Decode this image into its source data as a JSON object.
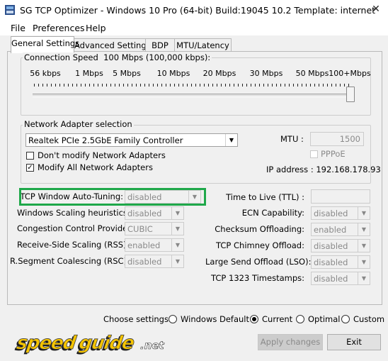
{
  "window": {
    "title": "SG TCP Optimizer - Windows 10 Pro (64-bit) Build:19045 10.2  Template: internet",
    "close_glyph": "✕"
  },
  "menu": [
    "File",
    "Preferences",
    "Help"
  ],
  "tabs": [
    "General Settings",
    "Advanced Settings",
    "BDP",
    "MTU/Latency"
  ],
  "connection_speed": {
    "label": "Connection Speed",
    "value_text": "100 Mbps (100,000 kbps):",
    "ticks": [
      "56 kbps",
      "1 Mbps",
      "5 Mbps",
      "10 Mbps",
      "20 Mbps",
      "30 Mbps",
      "50 Mbps",
      "100+Mbps"
    ],
    "slider_value_index": 7
  },
  "network_adapter": {
    "label": "Network Adapter selection",
    "selected": "Realtek PCIe 2.5GbE Family Controller",
    "dont_modify_label": "Don't modify Network Adapters",
    "dont_modify_checked": false,
    "modify_all_label": "Modify All Network Adapters",
    "modify_all_checked": true,
    "mtu_label": "MTU :",
    "mtu_value": "1500",
    "pppoe_label": "PPPoE",
    "pppoe_checked": false,
    "ip_label": "IP address : 192.168.178.93"
  },
  "left_settings": [
    {
      "label": "TCP Window Auto-Tuning:",
      "value": "disabled"
    },
    {
      "label": "Windows Scaling heuristics:",
      "value": "disabled"
    },
    {
      "label": "Congestion Control Provider:",
      "value": "CUBIC"
    },
    {
      "label": "Receive-Side Scaling (RSS):",
      "value": "enabled"
    },
    {
      "label": "R.Segment Coalescing (RSC):",
      "value": "disabled"
    }
  ],
  "right_settings": [
    {
      "label": "Time to Live (TTL) :",
      "value": ""
    },
    {
      "label": "ECN Capability:",
      "value": "disabled"
    },
    {
      "label": "Checksum Offloading:",
      "value": "enabled"
    },
    {
      "label": "TCP Chimney Offload:",
      "value": "disabled"
    },
    {
      "label": "Large Send Offload (LSO):",
      "value": "disabled"
    },
    {
      "label": "TCP 1323 Timestamps:",
      "value": "disabled"
    }
  ],
  "choose_settings": {
    "label": "Choose settings:",
    "options": [
      "Windows Default",
      "Current",
      "Optimal",
      "Custom"
    ],
    "selected": "Current"
  },
  "footer": {
    "logo_text": "speedguide.net",
    "apply_label": "Apply changes",
    "exit_label": "Exit"
  },
  "colors": {
    "highlight_frame": "#1fa84a",
    "logo_yellow": "#f5c400"
  }
}
